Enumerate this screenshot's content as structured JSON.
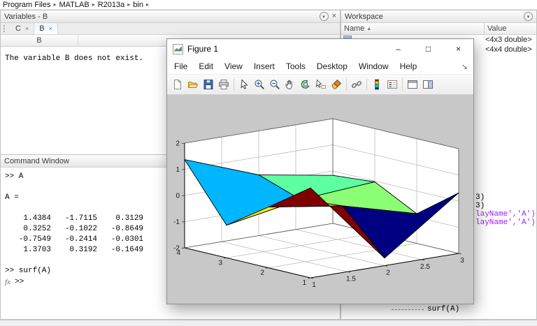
{
  "breadcrumb": {
    "items": [
      "Program Files",
      "MATLAB",
      "R2013a",
      "bin"
    ],
    "separator": "▸"
  },
  "panel_icons": {
    "menu_arrow": "▾",
    "close_glyph": "×"
  },
  "variables_panel": {
    "title": "Variables - B",
    "tabs": [
      {
        "label": "C",
        "close": "×"
      },
      {
        "label": "B",
        "close": "×"
      }
    ],
    "active_tab_index": 1,
    "column_header": "B",
    "message": "The variable B does not exist."
  },
  "command_window": {
    "title": "Command Window",
    "lines": [
      ">> A",
      "",
      "A =",
      "",
      "    1.4384   -1.7115    0.3129",
      "    0.3252   -0.1022   -0.8649",
      "   -0.7549   -0.2414   -0.0301",
      "    1.3703    0.3192   -0.1649",
      "",
      ">> surf(A)"
    ],
    "fx_label": "fx",
    "prompt": ">>"
  },
  "workspace": {
    "title": "Workspace",
    "name_header": "Name",
    "sort_arrow": "▲",
    "value_header": "Value",
    "rows": [
      {
        "name": "",
        "value": "<4x3 double>"
      },
      {
        "name": "",
        "value": "<4x4 double>"
      }
    ]
  },
  "editor_fragment": {
    "lines": [
      {
        "text": "3)",
        "color": "#000000"
      },
      {
        "text": "3)",
        "color": "#000000"
      },
      {
        "text": "layName','A')",
        "color": "#a020f0"
      },
      {
        "text": "layName','A')",
        "color": "#a020f0"
      }
    ]
  },
  "command_history_fragment": {
    "text": "surf(A)"
  },
  "figure_window": {
    "title": "Figure 1",
    "menus": [
      "File",
      "Edit",
      "View",
      "Insert",
      "Tools",
      "Desktop",
      "Window",
      "Help"
    ],
    "dock_arrow": "↘",
    "buttons": {
      "minimize": "–",
      "maximize": "□",
      "close": "×"
    },
    "toolbar_icons": [
      "new-figure",
      "open-file",
      "save-figure",
      "print-figure",
      "sep",
      "edit-plot",
      "zoom-in",
      "zoom-out",
      "pan",
      "rotate-3d",
      "data-cursor",
      "brush",
      "sep",
      "link-plots",
      "sep",
      "insert-colorbar",
      "insert-legend",
      "sep",
      "hide-plot-tools",
      "dock-figure"
    ]
  },
  "chart_data": {
    "type": "surface",
    "command": "surf(A)",
    "matrix": [
      [
        1.4384,
        -1.7115,
        0.3129
      ],
      [
        0.3252,
        -0.1022,
        -0.8649
      ],
      [
        -0.7549,
        -0.2414,
        -0.0301
      ],
      [
        1.3703,
        0.3192,
        -0.1649
      ]
    ],
    "x": [
      1,
      2,
      3
    ],
    "y": [
      1,
      2,
      3,
      4
    ],
    "xticks": [
      1,
      1.5,
      2,
      2.5,
      3
    ],
    "yticks": [
      1,
      2,
      3,
      4
    ],
    "zticks": [
      -2,
      -1,
      0,
      1,
      2
    ],
    "xlim": [
      1,
      3
    ],
    "ylim": [
      1,
      4
    ],
    "zlim": [
      -2,
      2
    ],
    "colormap": "jet",
    "shading": "flat",
    "edge_color": "#000000",
    "view": {
      "azimuth": -37.5,
      "elevation": 30
    },
    "grid": true,
    "wall_color": "#ffffff",
    "figure_background": "#c8c8c8"
  }
}
